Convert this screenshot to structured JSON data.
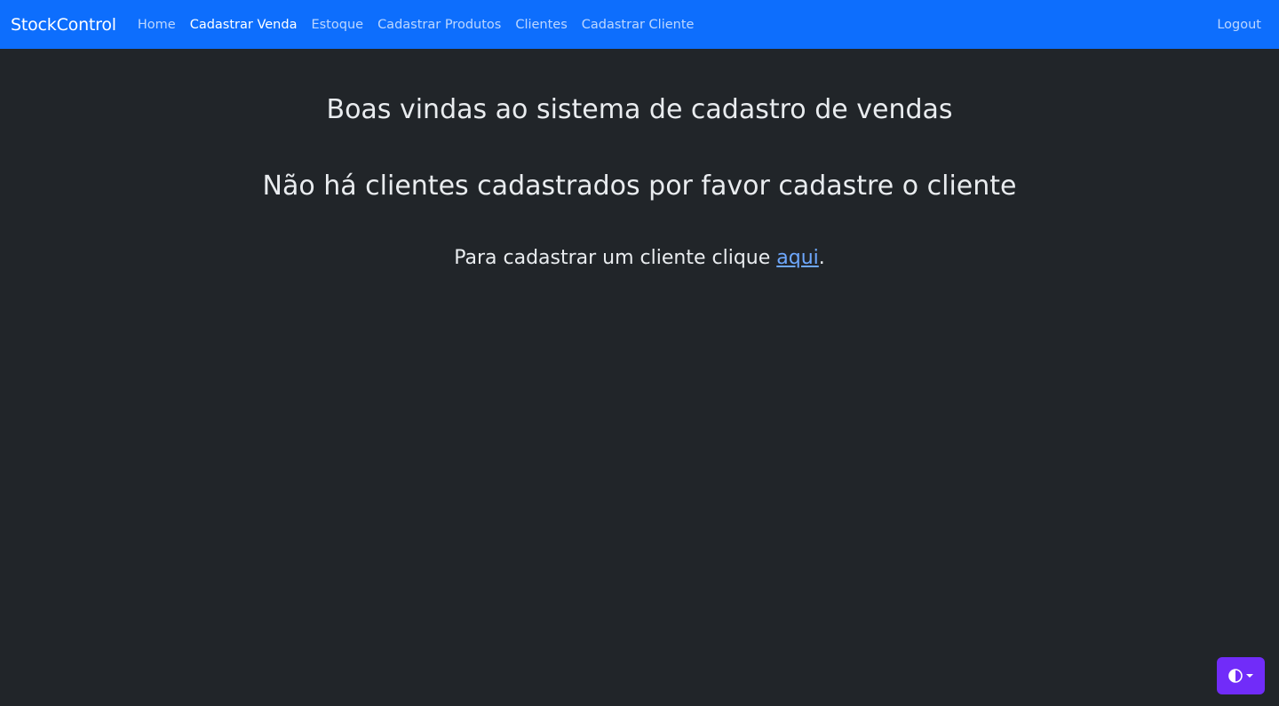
{
  "navbar": {
    "brand": "StockControl",
    "links": [
      {
        "label": "Home"
      },
      {
        "label": "Cadastrar Venda"
      },
      {
        "label": "Estoque"
      },
      {
        "label": "Cadastrar Produtos"
      },
      {
        "label": "Clientes"
      },
      {
        "label": "Cadastrar Cliente"
      }
    ],
    "logout": "Logout",
    "accent_color": "#0d6efd"
  },
  "main": {
    "welcome_heading": "Boas vindas ao sistema de cadastro de vendas",
    "no_clients_heading": "Não há clientes cadastrados por favor cadastre o cliente",
    "register_prefix": "Para cadastrar um cliente clique ",
    "register_link": "aqui",
    "register_suffix": "."
  },
  "theme_toggle": {
    "icon": "circle-half-icon",
    "color": "#712cf9"
  }
}
